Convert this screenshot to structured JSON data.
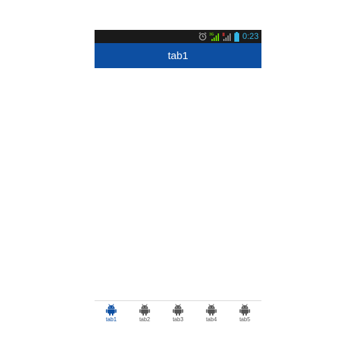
{
  "status_bar": {
    "time": "0:23",
    "network_label": "3G",
    "icons": [
      "alarm-icon",
      "signal-3g-icon",
      "signal-icon",
      "battery-icon"
    ]
  },
  "action_bar": {
    "title": "tab1"
  },
  "tabs": [
    {
      "label": "tab1",
      "icon": "android-icon",
      "active": true
    },
    {
      "label": "tab2",
      "icon": "android-icon",
      "active": false
    },
    {
      "label": "tab3",
      "icon": "android-icon",
      "active": false
    },
    {
      "label": "tab4",
      "icon": "android-icon",
      "active": false
    },
    {
      "label": "tab5",
      "icon": "android-icon",
      "active": false
    }
  ],
  "colors": {
    "action_bar": "#0d4fa2",
    "status_bar": "#1a1a1a",
    "active_tab": "#0d4fa2",
    "inactive_tab": "#555555",
    "clock": "#33b5e5",
    "signal": "#66cc00"
  }
}
